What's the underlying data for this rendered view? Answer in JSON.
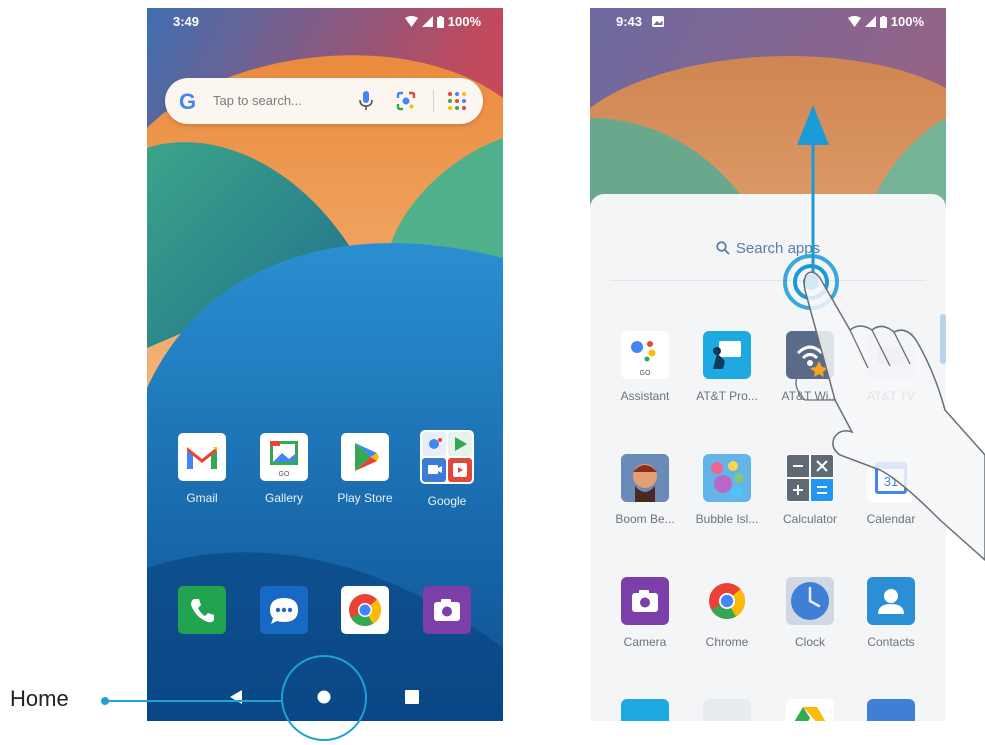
{
  "left_phone": {
    "status": {
      "time": "3:49",
      "battery": "100%"
    },
    "search": {
      "placeholder": "Tap to search..."
    },
    "apps": [
      {
        "label": "Gmail",
        "icon": "gmail-icon"
      },
      {
        "label": "Gallery",
        "icon": "gallery-icon"
      },
      {
        "label": "Play Store",
        "icon": "play-store-icon"
      },
      {
        "label": "Google",
        "icon": "google-folder-icon"
      }
    ],
    "dock": [
      {
        "icon": "phone-icon"
      },
      {
        "icon": "messages-icon"
      },
      {
        "icon": "chrome-icon"
      },
      {
        "icon": "camera-icon"
      }
    ],
    "nav": {
      "back": "back-icon",
      "home": "home-icon",
      "recents": "recents-icon"
    }
  },
  "annotation": {
    "home_label": "Home"
  },
  "right_phone": {
    "status": {
      "time": "9:43",
      "battery": "100%"
    },
    "drawer": {
      "search_placeholder": "Search apps",
      "apps": [
        {
          "label": "Assistant",
          "icon": "assistant-icon"
        },
        {
          "label": "AT&T Pro...",
          "icon": "att-pro-icon"
        },
        {
          "label": "AT&T Wi...",
          "icon": "att-wifi-icon"
        },
        {
          "label": "AT&T TV",
          "icon": "att-tv-icon"
        },
        {
          "label": "Boom Be...",
          "icon": "boom-beach-icon"
        },
        {
          "label": "Bubble Isl...",
          "icon": "bubble-island-icon"
        },
        {
          "label": "Calculator",
          "icon": "calculator-icon"
        },
        {
          "label": "Calendar",
          "icon": "calendar-icon"
        },
        {
          "label": "Camera",
          "icon": "camera-icon"
        },
        {
          "label": "Chrome",
          "icon": "chrome-icon"
        },
        {
          "label": "Clock",
          "icon": "clock-icon"
        },
        {
          "label": "Contacts",
          "icon": "contacts-icon"
        }
      ]
    }
  },
  "colors": {
    "annotation_blue": "#1fa0d6",
    "swipe_arrow": "#1a9ad6"
  }
}
